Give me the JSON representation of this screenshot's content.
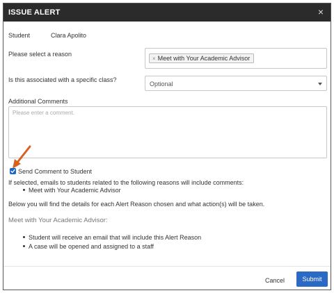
{
  "modal": {
    "title": "ISSUE ALERT",
    "close_symbol": "×"
  },
  "student": {
    "label": "Student",
    "name": "Clara Apolito"
  },
  "reason": {
    "label": "Please select a reason",
    "selected": "Meet with Your Academic Advisor",
    "chip_remove_symbol": "×"
  },
  "class_select": {
    "label": "Is this associated with a specific class?",
    "value": "Optional"
  },
  "comments": {
    "label": "Additional Comments",
    "placeholder": "Please enter a comment."
  },
  "send_comment": {
    "label": "Send Comment to Student",
    "checked": true
  },
  "info": {
    "emails_note": "If selected, emails to students related to the following reasons will include comments:",
    "reasons": [
      "Meet with Your Academic Advisor"
    ],
    "details_note": "Below you will find the details for each Alert Reason chosen and what action(s) will be taken."
  },
  "reason_details": {
    "title": "Meet with Your Academic Advisor:",
    "actions": [
      "Student will receive an email that will include this Alert Reason",
      "A case will be opened and assigned to a staff"
    ]
  },
  "footer": {
    "cancel_label": "Cancel",
    "submit_label": "Submit"
  },
  "colors": {
    "header_bg": "#2b2b2b",
    "accent": "#2a6ac4",
    "annotation_arrow": "#d9601f"
  },
  "icons": {
    "close": "close-icon",
    "chip_remove": "remove-chip-icon",
    "dropdown": "chevron-down-icon",
    "checkbox": "checkmark-icon",
    "annotation": "annotation-arrow-icon"
  }
}
